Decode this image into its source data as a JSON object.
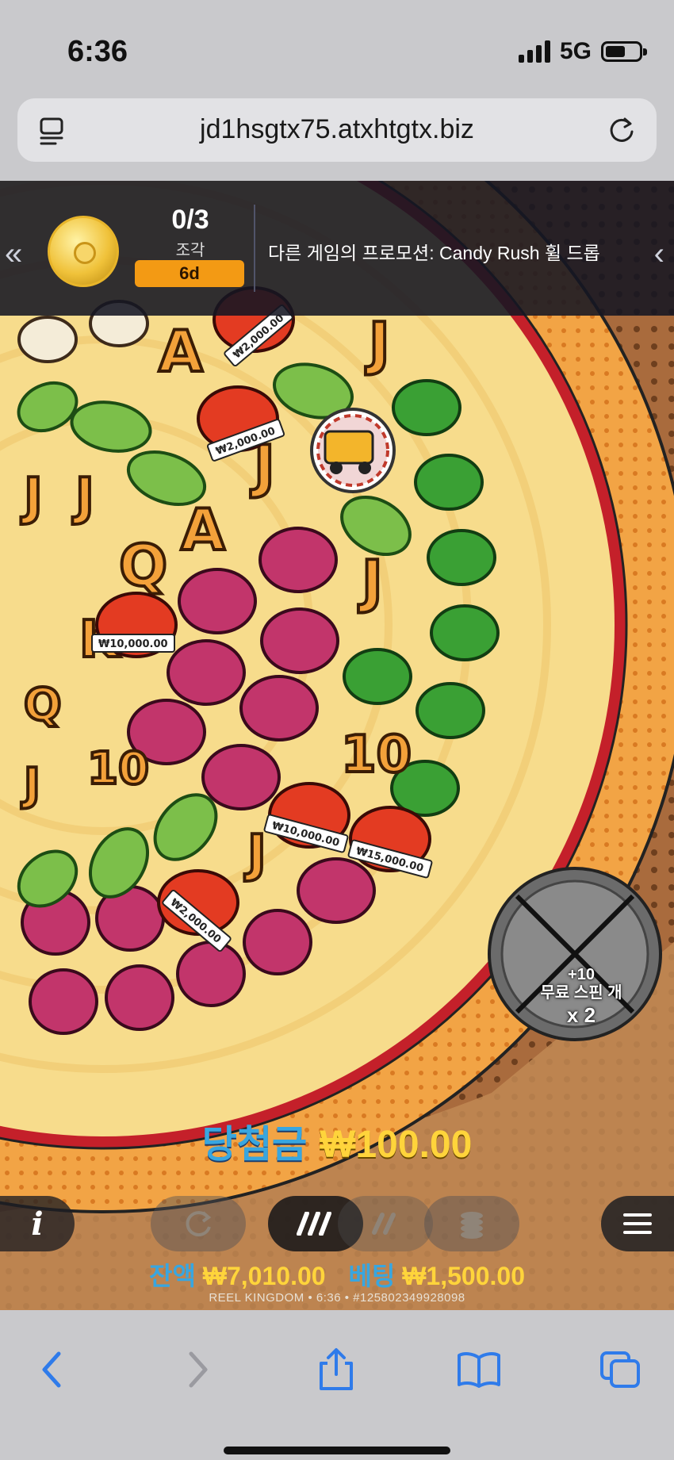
{
  "status": {
    "time": "6:36",
    "network": "5G"
  },
  "browser": {
    "url": "jd1hsgtx75.atxhtgtx.biz",
    "reader_icon": "reader-icon",
    "reload_icon": "reload-icon"
  },
  "promo": {
    "pieces_count": "0/3",
    "pieces_label": "조각",
    "timer": "6d",
    "text": "다른 게임의 프로모션: Candy Rush 휠 드롭",
    "left_arrow": "«",
    "right_arrow": "‹"
  },
  "reels": {
    "money_labels": [
      "₩2,000.00",
      "₩2,000.00",
      "₩10,000.00",
      "₩10,000.00",
      "₩15,000.00",
      "₩2,000.00"
    ]
  },
  "feature": {
    "plus": "+10",
    "label": "무료 스핀 개",
    "multiplier": "x 2"
  },
  "win": {
    "label": "당첨금",
    "amount": "₩100.00"
  },
  "controls": {
    "info": "i"
  },
  "balance": {
    "balance_label": "잔액",
    "balance_value": "₩7,010.00",
    "bet_label": "베팅",
    "bet_value": "₩1,500.00",
    "footer": "REEL KINGDOM • 6:36 • #125802349928098"
  },
  "colors": {
    "accent_blue": "#38a6e0",
    "accent_gold": "#ffd43b",
    "promo_orange": "#f39a14"
  }
}
